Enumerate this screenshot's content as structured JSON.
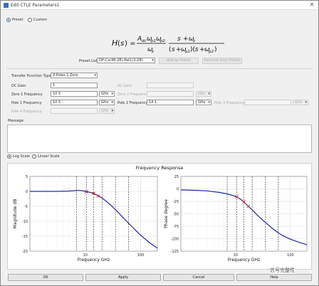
{
  "window": {
    "title": "Edit CTLE Parameters1",
    "close_glyph": "✕"
  },
  "mode": {
    "preset_label": "Preset",
    "custom_label": "Custom",
    "selected": "preset"
  },
  "preset": {
    "label": "Preset List:",
    "value": "DP-Cx(48-28)-Pat1(3-28)",
    "add_label": "Add as Preset",
    "remove_label": "Remove from Preset"
  },
  "params": {
    "tf_type_label": "Transfer Function Type:",
    "tf_type_value": "2 Poles 1 Zero",
    "dc_gain_label": "DC Gain",
    "dc_gain_value": "1",
    "ac_gain_label": "AC Gain",
    "ac_gain_value": "",
    "zero1_label": "Zero 1 Frequency",
    "zero1_value": "10.5",
    "zero1_unit": "GHz",
    "zero2_label": "Zero 2 Frequency",
    "zero2_value": "",
    "zero2_unit": "GHz",
    "pole1_label": "Pole 1 Frequency",
    "pole1_value": "10.5",
    "pole1_unit": "GHz",
    "pole2_label": "Pole 2 Frequency",
    "pole2_value": "14.1",
    "pole2_unit": "GHz",
    "pole3_label": "Pole 3 Frequency",
    "pole3_value": "",
    "pole3_unit": "GHz",
    "pole4_label": "Pole 4 Frequency",
    "pole4_value": "",
    "pole4_unit": "GHz"
  },
  "message": {
    "label": "Message",
    "text": ""
  },
  "scale": {
    "log_label": "Log Scale",
    "linear_label": "Linear Scale",
    "selected": "log"
  },
  "plots_title": "Frequency Response",
  "chart_data": [
    {
      "type": "line",
      "title": "",
      "xlabel": "Frequency   GHz",
      "ylabel": "Magnitude   dB",
      "xscale": "log",
      "xlim": [
        1,
        200
      ],
      "ylim": [
        -20,
        5
      ],
      "xticks": [
        10,
        100
      ],
      "yticks": [
        5,
        0,
        -5,
        -10,
        -15,
        -20
      ],
      "series": [
        {
          "color": "#1f2a9c",
          "x": [
            1,
            2,
            3,
            5,
            7,
            8,
            9,
            10,
            12,
            14.1,
            16,
            20,
            25,
            30,
            40,
            50,
            60,
            80,
            100,
            150,
            200
          ],
          "y": [
            0,
            0,
            0,
            0.1,
            0.3,
            0.3,
            0.2,
            0,
            -0.3,
            -0.7,
            -1.2,
            -2.2,
            -3.6,
            -4.9,
            -7.2,
            -9.1,
            -10.6,
            -12.9,
            -14.7,
            -17.4,
            -19.0
          ]
        }
      ],
      "markers": [
        {
          "x": 10.5,
          "y": -0.1
        },
        {
          "x": 14.1,
          "y": -0.7
        },
        {
          "x": 17,
          "y": -1.5
        }
      ],
      "vlines": [
        7,
        10.5,
        14.1,
        20,
        35,
        60
      ],
      "grid": true
    },
    {
      "type": "line",
      "title": "",
      "xlabel": "Frequency   GHz",
      "ylabel": "Phase   degree",
      "xscale": "log",
      "xlim": [
        1,
        200
      ],
      "ylim": [
        -125,
        25
      ],
      "xticks": [
        10,
        100
      ],
      "yticks": [
        25,
        0,
        -25,
        -50,
        -75,
        -100,
        -125
      ],
      "series": [
        {
          "color": "#1f2a9c",
          "x": [
            1,
            2,
            3,
            5,
            7,
            10,
            12,
            14.1,
            17,
            20,
            25,
            30,
            40,
            50,
            70,
            100,
            150,
            200
          ],
          "y": [
            -2,
            -3,
            -4,
            -7,
            -10,
            -15,
            -20,
            -26,
            -35,
            -42,
            -53,
            -61,
            -73,
            -82,
            -93,
            -101,
            -108,
            -112
          ]
        }
      ],
      "markers": [
        {
          "x": 10.5,
          "y": -16
        },
        {
          "x": 14.1,
          "y": -26
        },
        {
          "x": 17,
          "y": -35
        }
      ],
      "vlines": [
        7,
        10.5,
        14.1,
        20,
        35,
        60
      ],
      "grid": true
    }
  ],
  "footer": {
    "ok_label": "OK",
    "apply_label": "Apply",
    "cancel_label": "Cancel",
    "help_label": "Help",
    "watermark": "信号完整性"
  }
}
